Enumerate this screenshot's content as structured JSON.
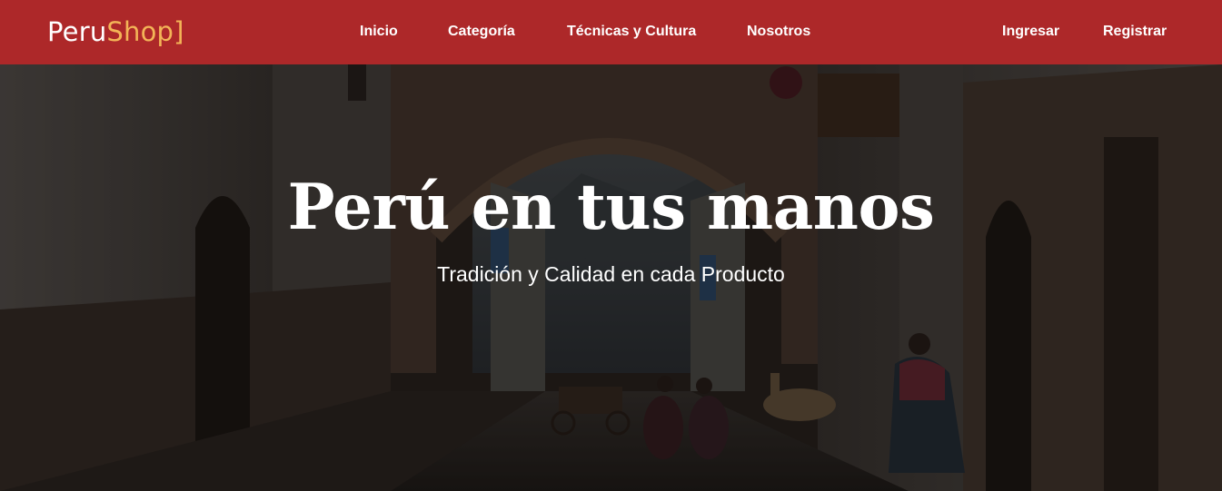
{
  "brand": {
    "name_part1": "Peru",
    "name_part2": "Shop]",
    "accent_color": "#f3b457",
    "nav_color": "#ad2829"
  },
  "nav": {
    "inicio": "Inicio",
    "categoria": "Categoría",
    "tecnicas": "Técnicas y Cultura",
    "nosotros": "Nosotros",
    "ingresar": "Ingresar",
    "registrar": "Registrar"
  },
  "hero": {
    "title": "Perú en tus manos",
    "subtitle": "Tradición y Calidad en cada Producto",
    "background_image": "colonial-street-with-stone-arch"
  }
}
